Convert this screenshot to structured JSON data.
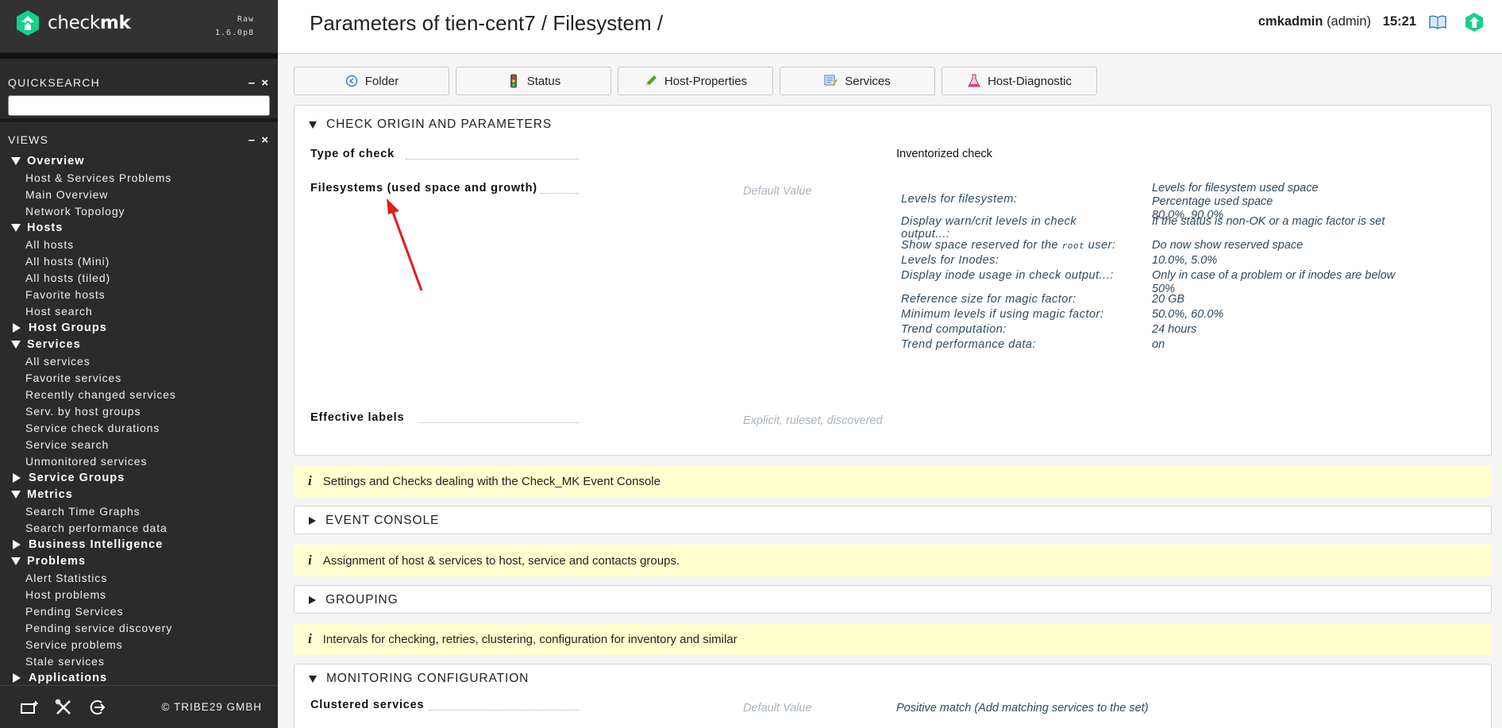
{
  "brand": {
    "logo_text_light": "check",
    "logo_text_bold": "mk",
    "edition": "Raw",
    "version": "1.6.0p8",
    "accent": "#13d389"
  },
  "sidebar": {
    "quicksearch_title": "QUICKSEARCH",
    "views_title": "VIEWS",
    "snapin_controls": "– ×",
    "groups": [
      {
        "label": "Overview",
        "open": true,
        "items": [
          "Host & Services Problems",
          "Main Overview",
          "Network Topology"
        ]
      },
      {
        "label": "Hosts",
        "open": true,
        "items": [
          "All hosts",
          "All hosts (Mini)",
          "All hosts (tiled)",
          "Favorite hosts",
          "Host search"
        ]
      },
      {
        "label": "Host Groups",
        "open": false,
        "items": []
      },
      {
        "label": "Services",
        "open": true,
        "items": [
          "All services",
          "Favorite services",
          "Recently changed services",
          "Serv. by host groups",
          "Service check durations",
          "Service search",
          "Unmonitored services"
        ]
      },
      {
        "label": "Service Groups",
        "open": false,
        "items": []
      },
      {
        "label": "Metrics",
        "open": true,
        "items": [
          "Search Time Graphs",
          "Search performance data"
        ]
      },
      {
        "label": "Business Intelligence",
        "open": false,
        "items": []
      },
      {
        "label": "Problems",
        "open": true,
        "items": [
          "Alert Statistics",
          "Host problems",
          "Pending Services",
          "Pending service discovery",
          "Service problems",
          "Stale services"
        ]
      },
      {
        "label": "Applications",
        "open": false,
        "items": []
      }
    ],
    "footer": {
      "copyright": "© TRIBE29 GMBH"
    }
  },
  "header": {
    "title": "Parameters of tien-cent7 / Filesystem /",
    "user": "cmkadmin",
    "role": "(admin)",
    "time": "15:21"
  },
  "buttons": [
    {
      "label": "Folder",
      "icon": "folder-back-icon"
    },
    {
      "label": "Status",
      "icon": "traffic-light-icon"
    },
    {
      "label": "Host-Properties",
      "icon": "pencil-icon"
    },
    {
      "label": "Services",
      "icon": "services-icon"
    },
    {
      "label": "Host-Diagnostic",
      "icon": "flask-icon"
    }
  ],
  "check_origin": {
    "title": "CHECK ORIGIN AND PARAMETERS",
    "type_label": "Type of check",
    "type_value": "Inventorized check",
    "fs_label": "Filesystems (used space and growth)",
    "fs_default": "Default Value",
    "params": [
      {
        "label": "Levels for filesystem:",
        "value_lines": [
          "Levels for filesystem used space",
          "Percentage used space",
          "80.0%, 90.0%"
        ]
      },
      {
        "label_lines": [
          "Display warn/crit levels in check",
          "output...:"
        ],
        "value_lines": [
          "If the status is non-OK or a magic factor is set"
        ]
      },
      {
        "label_pre": "Show space reserved for the ",
        "label_code": "root",
        "label_post": " user:",
        "value_lines": [
          "Do now show reserved space"
        ]
      },
      {
        "label": "Levels for Inodes:",
        "value_lines": [
          "10.0%, 5.0%"
        ]
      },
      {
        "label": "Display inode usage in check output...:",
        "value_lines": [
          "Only in case of a problem or if inodes are below",
          "50%"
        ]
      },
      {
        "label": "Reference size for magic factor:",
        "value_lines": [
          "20 GB"
        ]
      },
      {
        "label": "Minimum levels if using magic factor:",
        "value_lines": [
          "50.0%, 60.0%"
        ]
      },
      {
        "label": "Trend computation:",
        "value_lines": [
          "24 hours"
        ]
      },
      {
        "label": "Trend performance data:",
        "value_lines": [
          "on"
        ]
      }
    ],
    "labels_label": "Effective labels",
    "labels_value": "Explicit, ruleset, discovered"
  },
  "info_1": "Settings and Checks dealing with the Check_MK Event Console",
  "event_console_title": "EVENT CONSOLE",
  "info_2": "Assignment of host & services to host, service and contacts groups.",
  "grouping_title": "GROUPING",
  "info_3": "Intervals for checking, retries, clustering, configuration for inventory and similar",
  "monitoring": {
    "title": "MONITORING CONFIGURATION",
    "clustered_label": "Clustered services",
    "clustered_default": "Default Value",
    "clustered_value": "Positive match (Add matching services to the set)"
  }
}
